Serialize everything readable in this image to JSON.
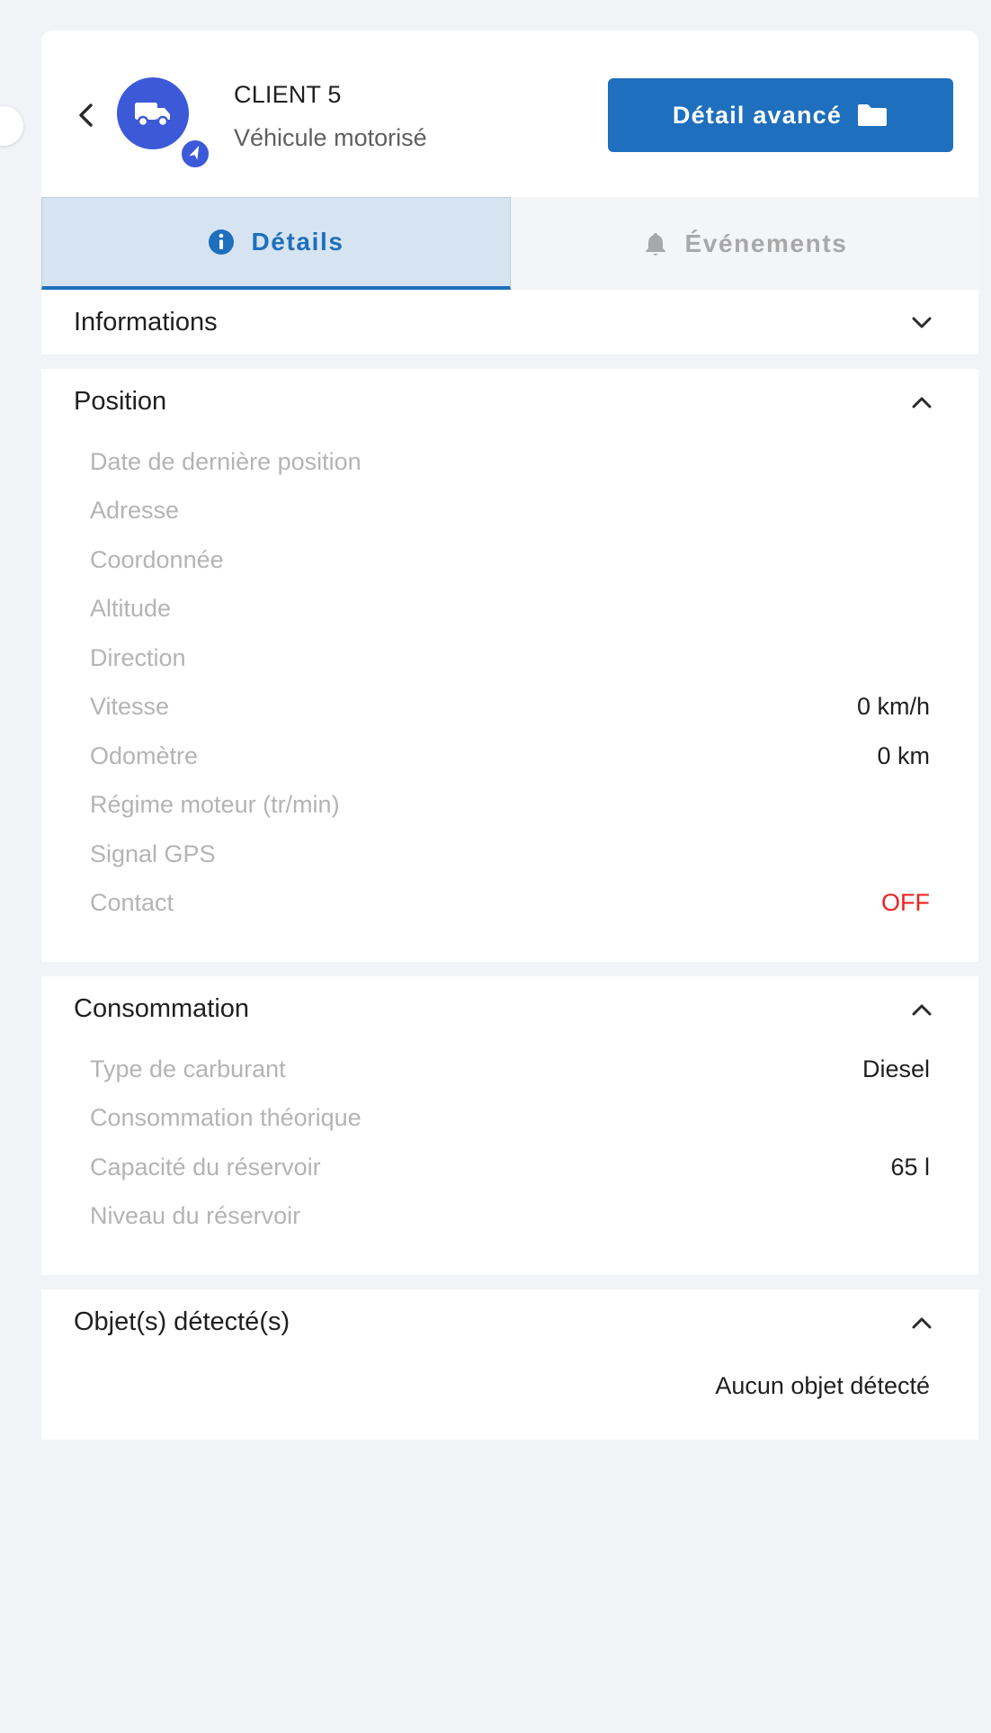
{
  "header": {
    "client_name": "CLIENT 5",
    "vehicle_type": "Véhicule motorisé",
    "advanced_button_label": "Détail avancé",
    "avatar_icon": "truck-icon",
    "badge_icon": "navigation-arrow-icon",
    "avatar_color": "#3c59d8",
    "button_color": "#1e6fbd"
  },
  "tabs": [
    {
      "label": "Détails",
      "icon": "info-circle-icon",
      "active": true
    },
    {
      "label": "Événements",
      "icon": "bell-icon",
      "active": false
    }
  ],
  "sections": {
    "informations": {
      "title": "Informations",
      "expanded": false
    },
    "position": {
      "title": "Position",
      "expanded": true,
      "rows": [
        {
          "label": "Date de dernière position",
          "value": ""
        },
        {
          "label": "Adresse",
          "value": ""
        },
        {
          "label": "Coordonnée",
          "value": ""
        },
        {
          "label": "Altitude",
          "value": ""
        },
        {
          "label": "Direction",
          "value": ""
        },
        {
          "label": "Vitesse",
          "value": "0 km/h"
        },
        {
          "label": "Odomètre",
          "value": "0 km"
        },
        {
          "label": "Régime moteur (tr/min)",
          "value": ""
        },
        {
          "label": "Signal GPS",
          "value": ""
        },
        {
          "label": "Contact",
          "value": "OFF"
        }
      ]
    },
    "consommation": {
      "title": "Consommation",
      "expanded": true,
      "rows": [
        {
          "label": "Type de carburant",
          "value": "Diesel"
        },
        {
          "label": "Consommation théorique",
          "value": ""
        },
        {
          "label": "Capacité du réservoir",
          "value": "65 l"
        },
        {
          "label": "Niveau du réservoir",
          "value": ""
        }
      ]
    },
    "objets": {
      "title": "Objet(s) détecté(s)",
      "expanded": true,
      "empty_text": "Aucun objet détecté"
    }
  },
  "colors": {
    "off_status": "#f02020",
    "label_gray": "#b4b4b4",
    "active_tab_bg": "#d6e4f1"
  }
}
